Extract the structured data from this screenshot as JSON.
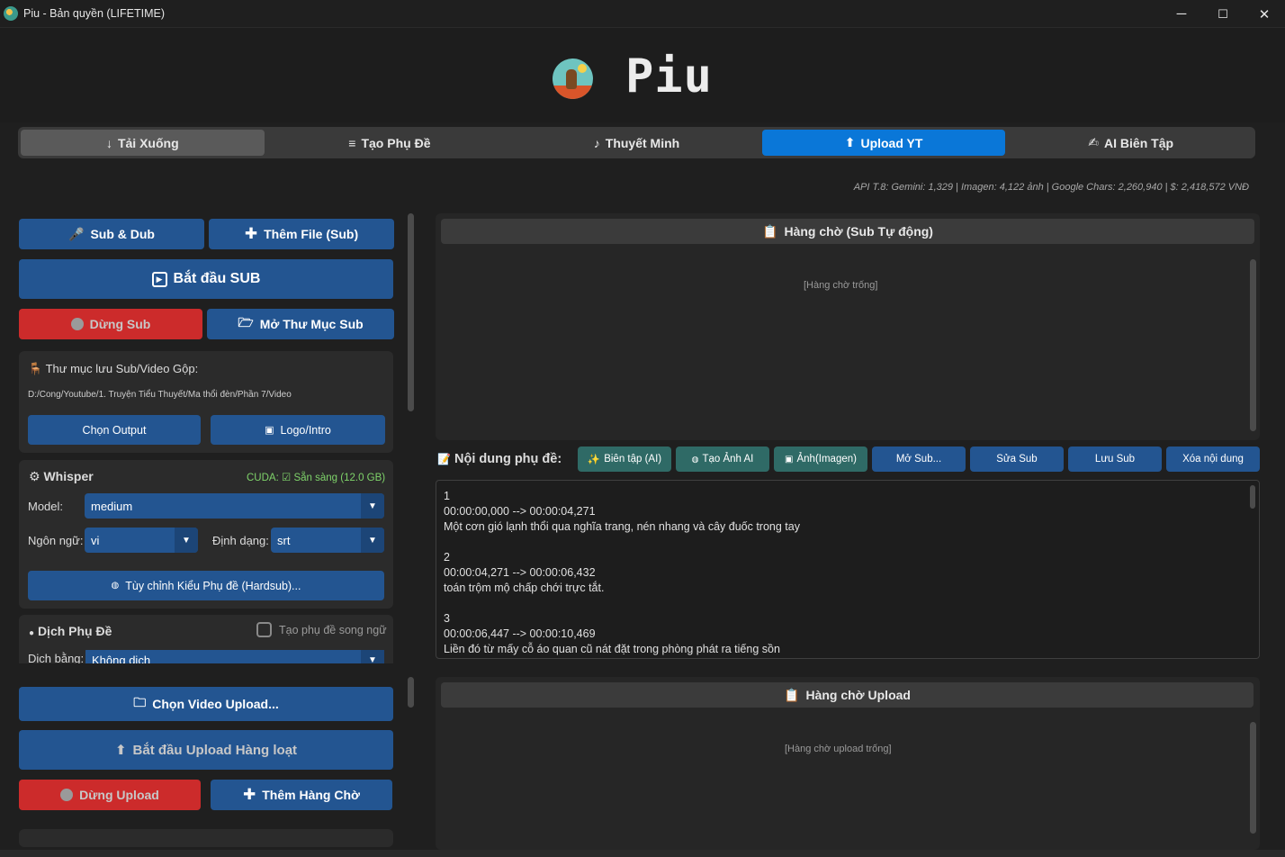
{
  "window": {
    "title": "Piu - Bản quyền (LIFETIME)",
    "minimize": "─",
    "maximize": "☐",
    "close": "✕"
  },
  "header": {
    "app_name": "Piu"
  },
  "tabs": [
    {
      "icon": "↓",
      "label": "Tải Xuống"
    },
    {
      "icon": "≡",
      "label": "Tạo Phụ Đề"
    },
    {
      "icon": "♪",
      "label": "Thuyết Minh"
    },
    {
      "icon": "⬆",
      "label": "Upload YT"
    },
    {
      "icon": "✍",
      "label": "AI Biên Tập"
    }
  ],
  "api_status": "API T.8: Gemini: 1,329 | Imagen: 4,122 ảnh | Google Chars: 2,260,940 | $: 2,418,572 VNĐ",
  "left": {
    "sub_dub": "Sub & Dub",
    "add_file": "Thêm File (Sub)",
    "start_sub": "Bắt đầu SUB",
    "stop_sub": "Dừng Sub",
    "open_folder": "Mở Thư Mục Sub",
    "output_label": "Thư mục lưu Sub/Video Gộp:",
    "output_path": "D:/Cong/Youtube/1. Truyện Tiểu Thuyết/Ma thổi đèn/Phần 7/Video",
    "choose_output": "Chọn Output",
    "logo_intro": "Logo/Intro",
    "whisper_title": "Whisper",
    "cuda_status": "CUDA: ☑ Sẵn sàng (12.0 GB)",
    "model_label": "Model:",
    "model_value": "medium",
    "lang_label": "Ngôn ngữ:",
    "lang_value": "vi",
    "format_label": "Định dạng:",
    "format_value": "srt",
    "style_button": "Tùy chỉnh Kiểu Phụ đề (Hardsub)...",
    "translate_title": "Dịch Phụ Đề",
    "bilingual_label": "Tạo phụ đề song ngữ",
    "translate_by_label": "Dịch bằng:",
    "translate_by_value": "Không dịch",
    "choose_video": "Chọn Video Upload...",
    "start_upload": "Bắt đầu Upload Hàng loạt",
    "stop_upload": "Dừng Upload",
    "add_queue": "Thêm Hàng Chờ"
  },
  "right": {
    "sub_queue_title": "Hàng chờ (Sub Tự động)",
    "sub_queue_empty": "[Hàng chờ trống]",
    "content_label": "Nội dung phụ đề:",
    "toolbar": [
      "Biên tập (AI)",
      "Tạo Ảnh AI",
      "Ảnh(Imagen)",
      "Mở Sub...",
      "Sửa Sub",
      "Lưu Sub",
      "Xóa nội dung"
    ],
    "srt_text": "1\n00:00:00,000 --> 00:00:04,271\nMột cơn gió lạnh thổi qua nghĩa trang, nén nhang và cây đuốc trong tay\n\n2\n00:00:04,271 --> 00:00:06,432\ntoán trộm mộ chấp chới trực tắt.\n\n3\n00:00:06,447 --> 00:00:10,469\nLiền đó từ mấy cỗ áo quan cũ nát đặt trong phòng phát ra tiếng sồn",
    "upload_queue_title": "Hàng chờ Upload",
    "upload_queue_empty": "[Hàng chờ upload trống]"
  },
  "colors": {
    "accent": "#0a77d8",
    "button": "#235591",
    "danger": "#cc2b2b",
    "cuda_ok": "#7fd36a"
  }
}
